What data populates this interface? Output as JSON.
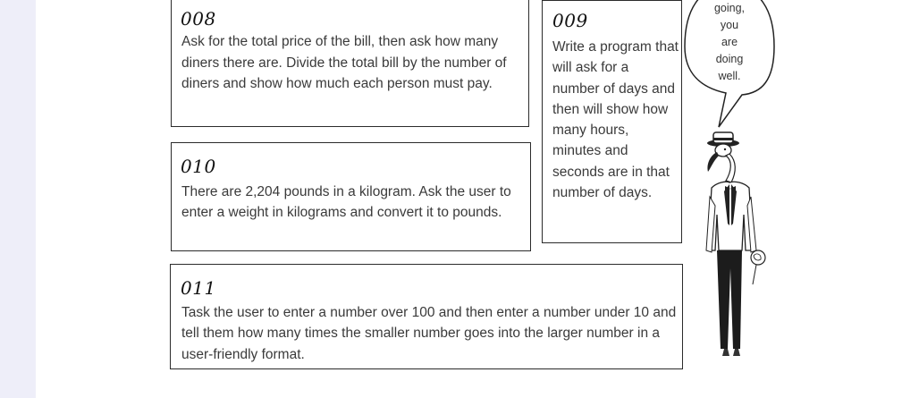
{
  "cards": {
    "c008": {
      "number": "008",
      "text": "Ask for the total price of the bill, then ask how many diners there are. Divide the total bill by the number of diners and show how much each person must pay."
    },
    "c009": {
      "number": "009",
      "text": "Write a program that will ask for a number of days and then will show how many hours, minutes and seconds are in that number of days."
    },
    "c010": {
      "number": "010",
      "text": "There are 2,204 pounds in a kilogram. Ask the user to enter a weight in kilograms and convert it to pounds."
    },
    "c011": {
      "number": "011",
      "text": "Task the user to enter a number over 100 and then enter a number under 10 and tell them how many times the smaller number goes into the larger number in a user-friendly format."
    }
  },
  "speech_bubble": {
    "lines": [
      "going,",
      "you",
      "are",
      "doing",
      "well."
    ]
  },
  "illustration": {
    "icon": "flamingo-in-suit-illustration"
  }
}
